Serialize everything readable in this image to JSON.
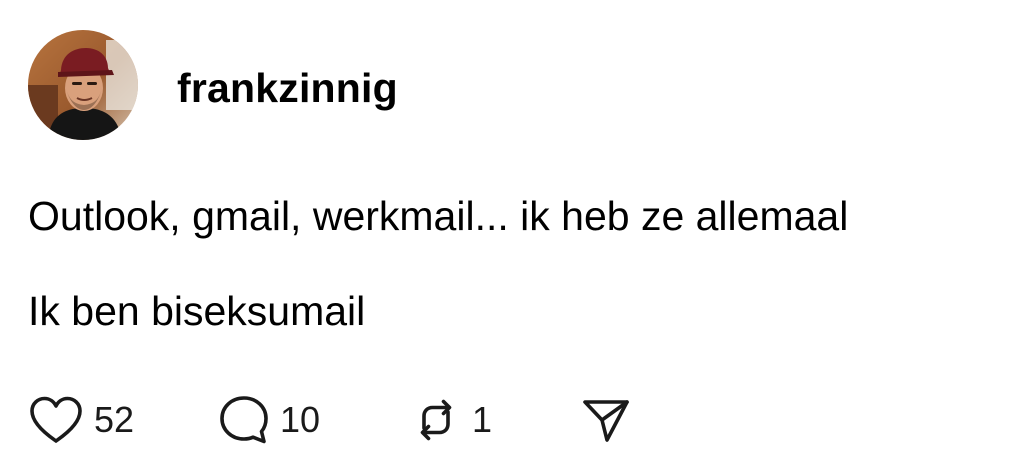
{
  "post": {
    "username": "frankzinnig",
    "avatar_icon": "profile-photo",
    "text_lines": [
      "Outlook, gmail, werkmail... ik heb ze allemaal",
      "Ik ben biseksumail"
    ]
  },
  "actions": {
    "like": {
      "icon": "heart-icon",
      "count": "52"
    },
    "comment": {
      "icon": "comment-bubble-icon",
      "count": "10"
    },
    "repost": {
      "icon": "repost-icon",
      "count": "1"
    },
    "share": {
      "icon": "send-icon"
    }
  },
  "colors": {
    "text": "#000000",
    "icon": "#1a1a1a",
    "background": "#ffffff"
  }
}
